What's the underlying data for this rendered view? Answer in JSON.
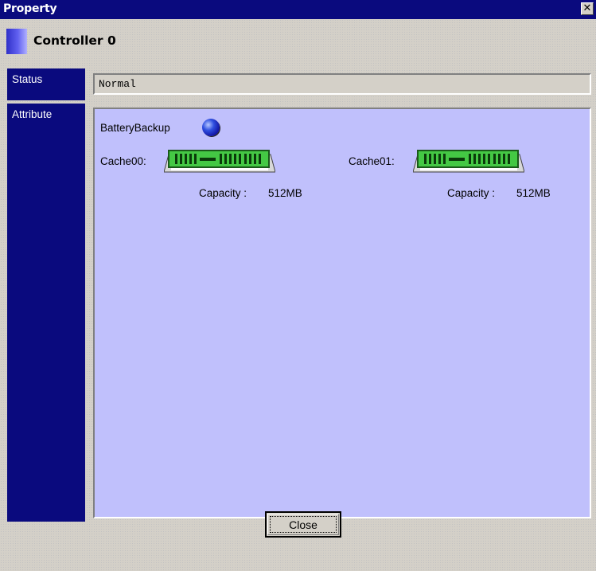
{
  "window": {
    "title": "Property",
    "close_glyph": "✕"
  },
  "header": {
    "title": "Controller 0"
  },
  "status": {
    "label": "Status",
    "value": "Normal"
  },
  "attribute": {
    "label": "Attribute",
    "battery_label": "BatteryBackup",
    "battery_icon": "blue-sphere-icon",
    "caches": [
      {
        "label": "Cache00:",
        "capacity_label": "Capacity :",
        "capacity_value": "512MB",
        "icon": "memory-module-icon"
      },
      {
        "label": "Cache01:",
        "capacity_label": "Capacity :",
        "capacity_value": "512MB",
        "icon": "memory-module-icon"
      }
    ]
  },
  "footer": {
    "close_label": "Close"
  },
  "colors": {
    "titlebar": "#0a0a7e",
    "label_column": "#0a0a7e",
    "attribute_panel": "#c0c0fc",
    "dialog_bg": "#d4d0c8",
    "memory_green": "#44c844"
  }
}
